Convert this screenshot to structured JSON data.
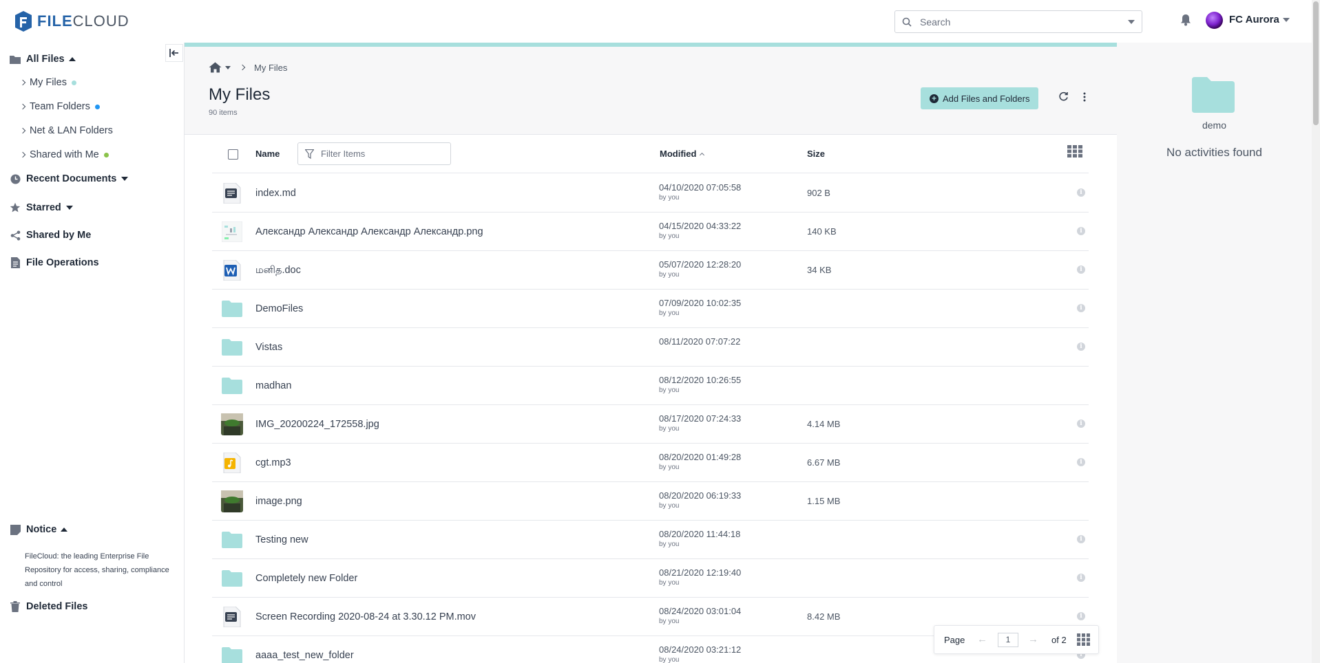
{
  "header": {
    "logo_prefix": "FILE",
    "logo_suffix": "CLOUD",
    "search_placeholder": "Search",
    "user_name": "FC Aurora"
  },
  "sidebar": {
    "all_files": "All Files",
    "sub_items": [
      {
        "label": "My Files",
        "dot": "#a7dfdd"
      },
      {
        "label": "Team Folders",
        "dot": "#2196f3"
      },
      {
        "label": "Net & LAN Folders",
        "dot": ""
      },
      {
        "label": "Shared with Me",
        "dot": "#8bc34a"
      }
    ],
    "recent": "Recent Documents",
    "starred": "Starred",
    "shared_by_me": "Shared by Me",
    "file_operations": "File Operations",
    "notice": "Notice",
    "notice_text": "FileCloud: the leading Enterprise File Repository for access, sharing, compliance and control",
    "deleted": "Deleted Files"
  },
  "main": {
    "breadcrumb_current": "My Files",
    "title": "My Files",
    "item_count": "90 items",
    "add_button": "Add Files and Folders",
    "columns": {
      "name": "Name",
      "modified": "Modified",
      "size": "Size"
    },
    "filter_placeholder": "Filter Items",
    "files": [
      {
        "name": "index.md",
        "date": "04/10/2020 07:05:58",
        "by": "by you",
        "size": "902 B",
        "icon": "text-file-icon",
        "info": true
      },
      {
        "name": "Александр Александр Александр Александр.png",
        "date": "04/15/2020 04:33:22",
        "by": "by you",
        "size": "140 KB",
        "icon": "image-thumbnail-icon",
        "info": true
      },
      {
        "name": "மனித.doc",
        "date": "05/07/2020 12:28:20",
        "by": "by you",
        "size": "34 KB",
        "icon": "word-file-icon",
        "info": true
      },
      {
        "name": "DemoFiles",
        "date": "07/09/2020 10:02:35",
        "by": "by you",
        "size": "",
        "icon": "folder-icon",
        "info": true
      },
      {
        "name": "Vistas",
        "date": "08/11/2020 07:07:22",
        "by": "",
        "size": "",
        "icon": "folder-icon",
        "info": true
      },
      {
        "name": "madhan",
        "date": "08/12/2020 10:26:55",
        "by": "by you",
        "size": "",
        "icon": "folder-icon",
        "info": false
      },
      {
        "name": "IMG_20200224_172558.jpg",
        "date": "08/17/2020 07:24:33",
        "by": "by you",
        "size": "4.14 MB",
        "icon": "photo-thumbnail-icon",
        "info": true
      },
      {
        "name": "cgt.mp3",
        "date": "08/20/2020 01:49:28",
        "by": "by you",
        "size": "6.67 MB",
        "icon": "audio-file-icon",
        "info": true
      },
      {
        "name": "image.png",
        "date": "08/20/2020 06:19:33",
        "by": "by you",
        "size": "1.15 MB",
        "icon": "photo-thumbnail-icon",
        "info": false
      },
      {
        "name": "Testing new",
        "date": "08/20/2020 11:44:18",
        "by": "by you",
        "size": "",
        "icon": "folder-icon",
        "info": true
      },
      {
        "name": "Completely new Folder",
        "date": "08/21/2020 12:19:40",
        "by": "by you",
        "size": "",
        "icon": "folder-icon",
        "info": true
      },
      {
        "name": "Screen Recording 2020-08-24 at 3.30.12 PM.mov",
        "date": "08/24/2020 03:01:04",
        "by": "by you",
        "size": "8.42 MB",
        "icon": "text-file-icon",
        "info": true
      },
      {
        "name": "aaaa_test_new_folder",
        "date": "08/24/2020 03:21:12",
        "by": "by you",
        "size": "",
        "icon": "folder-icon",
        "info": true
      }
    ],
    "pager": {
      "label": "Page",
      "current": "1",
      "of": "of 2"
    }
  },
  "right_panel": {
    "folder_name": "demo",
    "empty_text": "No activities found"
  },
  "colors": {
    "accent": "#a7dfdd",
    "brand": "#2563a8"
  }
}
